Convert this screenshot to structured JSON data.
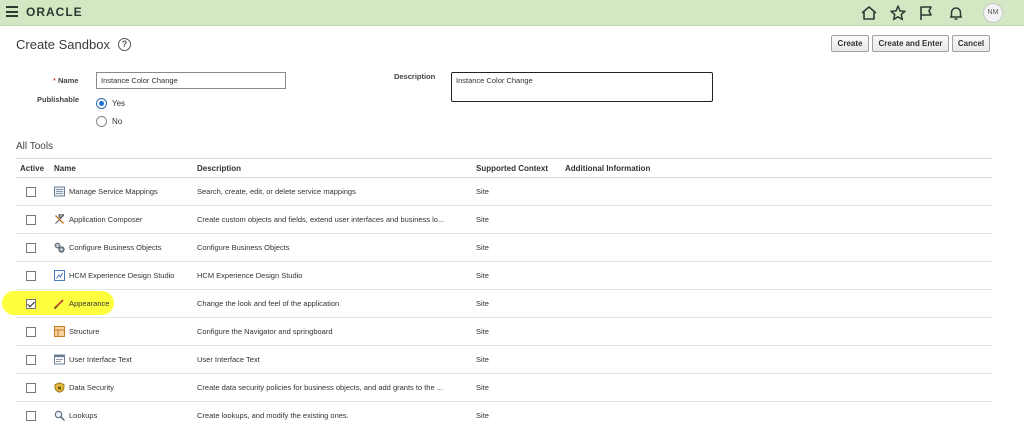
{
  "brand": {
    "logo": "ORACLE",
    "user_initials": "NM"
  },
  "topbar_icons": [
    "home-icon",
    "star-icon",
    "flag-icon",
    "bell-icon"
  ],
  "page": {
    "title": "Create Sandbox"
  },
  "actions": {
    "create": "Create",
    "create_enter": "Create and Enter",
    "cancel": "Cancel"
  },
  "form": {
    "name_label": "Name",
    "name_required": "*",
    "name_value": "Instance Color Change",
    "description_label": "Description",
    "description_value": "Instance Color Change",
    "publishable_label": "Publishable",
    "publishable_options": [
      "Yes",
      "No"
    ],
    "publishable_selected": "Yes"
  },
  "tools": {
    "section_title": "All Tools",
    "headers": {
      "active": "Active",
      "name": "Name",
      "description": "Description",
      "context": "Supported Context",
      "info": "Additional Information"
    },
    "rows": [
      {
        "active": false,
        "icon": "service-mappings-icon",
        "name": "Manage Service Mappings",
        "description": "Search, create, edit, or delete service mappings",
        "context": "Site"
      },
      {
        "active": false,
        "icon": "tools-icon",
        "name": "Application Composer",
        "description": "Create custom objects and fields, extend user interfaces and business lo...",
        "context": "Site"
      },
      {
        "active": false,
        "icon": "gears-icon",
        "name": "Configure Business Objects",
        "description": "Configure Business Objects",
        "context": "Site"
      },
      {
        "active": false,
        "icon": "design-studio-icon",
        "name": "HCM Experience Design Studio",
        "description": "HCM Experience Design Studio",
        "context": "Site"
      },
      {
        "active": true,
        "icon": "paintbrush-icon",
        "name": "Appearance",
        "description": "Change the look and feel of the application",
        "context": "Site"
      },
      {
        "active": false,
        "icon": "structure-icon",
        "name": "Structure",
        "description": "Configure the Navigator and springboard",
        "context": "Site"
      },
      {
        "active": false,
        "icon": "ui-text-icon",
        "name": "User Interface Text",
        "description": "User Interface Text",
        "context": "Site"
      },
      {
        "active": false,
        "icon": "shield-icon",
        "name": "Data Security",
        "description": "Create data security policies for business objects, and add grants to the ...",
        "context": "Site"
      },
      {
        "active": false,
        "icon": "magnifier-icon",
        "name": "Lookups",
        "description": "Create lookups, and modify the existing ones.",
        "context": "Site"
      }
    ]
  },
  "colors": {
    "topbar": "#d3e8c2",
    "highlight": "#fdff2a",
    "radio_accent": "#1f6fd1"
  }
}
